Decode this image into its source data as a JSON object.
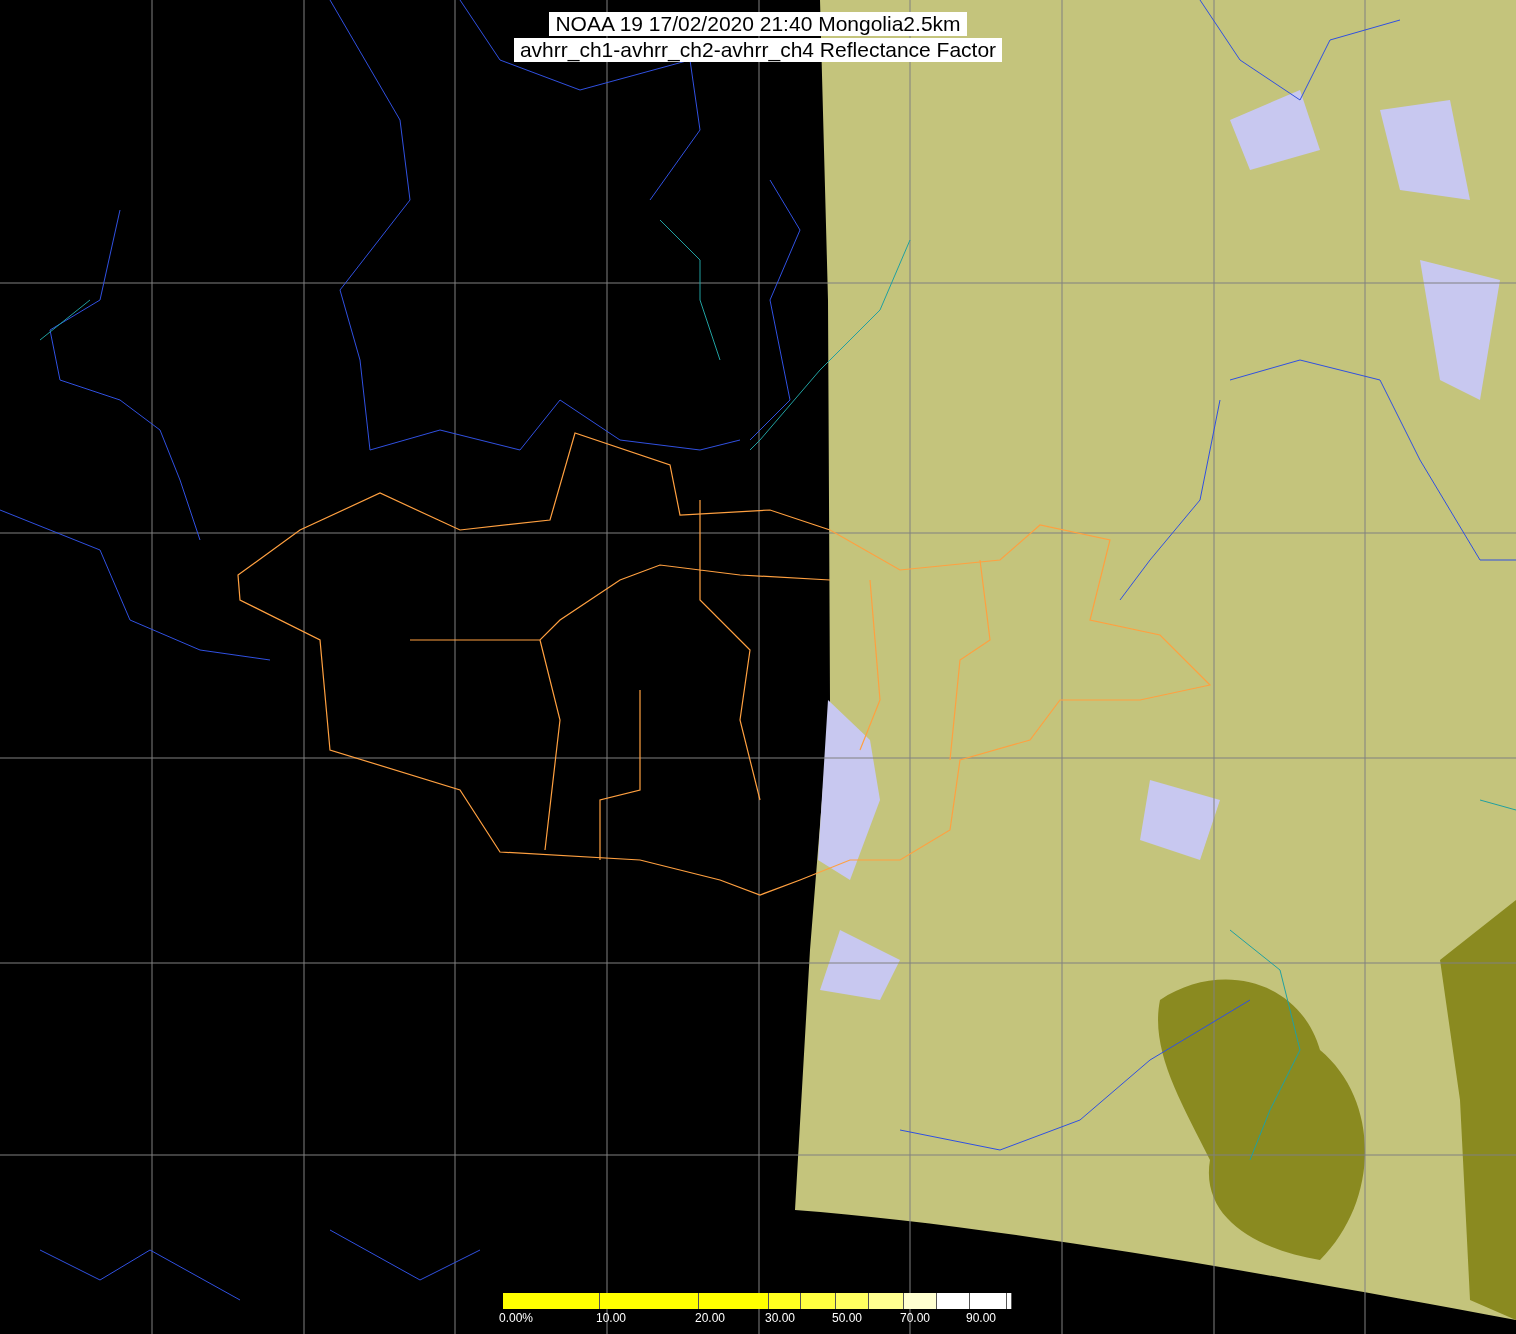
{
  "title": {
    "lines": [
      "NOAA 19 17/02/2020 21:40 Mongolia2.5km",
      "avhrr_ch1-avhrr_ch2-avhrr_ch4 Reflectance Factor"
    ]
  },
  "colorbar": {
    "segments": [
      {
        "color": "#ffff00",
        "label": "0.00%"
      },
      {
        "color": "#ffff00",
        "label": "10.00"
      },
      {
        "color": "#ffff00",
        "label": "20.00"
      },
      {
        "color": "#ffff20",
        "label": "30.00"
      },
      {
        "color": "#ffff40"
      },
      {
        "color": "#ffff60",
        "label": "50.00"
      },
      {
        "color": "#ffff90"
      },
      {
        "color": "#ffffd0",
        "label": "70.00"
      },
      {
        "color": "#ffffff"
      },
      {
        "color": "#ffffff",
        "label": "90.00"
      },
      {
        "color": "#ffffff"
      }
    ]
  }
}
